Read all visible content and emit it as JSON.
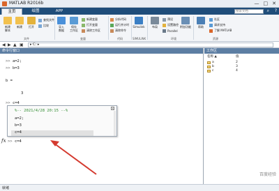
{
  "window": {
    "title": "MATLAB R2016b",
    "min": "—",
    "max": "□",
    "close": "✕"
  },
  "tabs": [
    {
      "label": "主页",
      "active": true
    },
    {
      "label": "绘图",
      "active": false
    },
    {
      "label": "APP",
      "active": false
    }
  ],
  "search": {
    "placeholder": "搜索文档"
  },
  "toolstrip": {
    "big_tools": [
      {
        "label": "新建\n脚本",
        "icon": "new-script-icon",
        "color": "#f2c14e"
      },
      {
        "label": "新建",
        "icon": "new-icon",
        "color": "#f2c14e"
      },
      {
        "label": "打开",
        "icon": "open-icon",
        "color": "#e3b23c"
      },
      {
        "label": "导入\n数据",
        "icon": "import-data-icon",
        "color": "#4a90d9"
      },
      {
        "label": "保存\n工作区",
        "icon": "save-workspace-icon",
        "color": "#5a9bd5"
      },
      {
        "label": "Simulink",
        "icon": "simulink-icon",
        "color": "#3b7fc4"
      },
      {
        "label": "布局",
        "icon": "layout-icon",
        "color": "#7a8a9a"
      },
      {
        "label": "附加功能",
        "icon": "add-ons-icon",
        "color": "#6a8fb5"
      },
      {
        "label": "帮助",
        "icon": "help-icon",
        "color": "#4a7fb5"
      }
    ],
    "small_tools": [
      {
        "label": "查找文件",
        "icon": "find-files-icon"
      },
      {
        "label": "比较",
        "icon": "compare-icon"
      },
      {
        "label": "新建变量",
        "icon": "new-variable-icon"
      },
      {
        "label": "打开变量",
        "icon": "open-variable-icon"
      },
      {
        "label": "清除工作区",
        "icon": "clear-workspace-icon"
      },
      {
        "label": "分析代码",
        "icon": "analyze-code-icon"
      },
      {
        "label": "运行并计时",
        "icon": "run-time-icon"
      },
      {
        "label": "清除命令",
        "icon": "clear-commands-icon"
      },
      {
        "label": "预设",
        "icon": "preferences-icon"
      },
      {
        "label": "设置路径",
        "icon": "set-path-icon"
      },
      {
        "label": "Parallel",
        "icon": "parallel-icon"
      },
      {
        "label": "社区",
        "icon": "community-icon"
      },
      {
        "label": "请求支持",
        "icon": "request-support-icon"
      },
      {
        "label": "了解 MATLAB",
        "icon": "learn-matlab-icon"
      }
    ],
    "groups": [
      "文件",
      "变量",
      "代码",
      "SIMULINK",
      "环境",
      "资源"
    ]
  },
  "addressbar": {
    "path": "▸ C: ▸"
  },
  "command_window": {
    "title": "命令行窗口",
    "lines": [
      {
        "prompt": ">>",
        "text": "a=2;"
      },
      {
        "prompt": ">>",
        "text": "b=3"
      },
      {
        "prompt": "",
        "text": "b ="
      },
      {
        "prompt": "",
        "text": "3"
      },
      {
        "prompt": ">>",
        "text": "c=4"
      }
    ],
    "current_prompt": ">>",
    "current_input": "c=4",
    "fx": "fx"
  },
  "history": {
    "header": "%-- 2021/4/28 20:15 --%",
    "items": [
      "a=2;",
      "b=3",
      "c=4"
    ],
    "selected_index": 2,
    "close": "×"
  },
  "workspace": {
    "title": "工作区",
    "columns": [
      "名称 ▲",
      "值"
    ],
    "variables": [
      {
        "name": "a",
        "value": "2"
      },
      {
        "name": "b",
        "value": "3"
      },
      {
        "name": "c",
        "value": "4"
      }
    ]
  },
  "statusbar": {
    "text": "就绪"
  },
  "watermark": "百度经验",
  "colors": {
    "ribbon": "#1f4d7a",
    "arrow": "#d43a2f",
    "history_header": "#2e8b2e"
  }
}
